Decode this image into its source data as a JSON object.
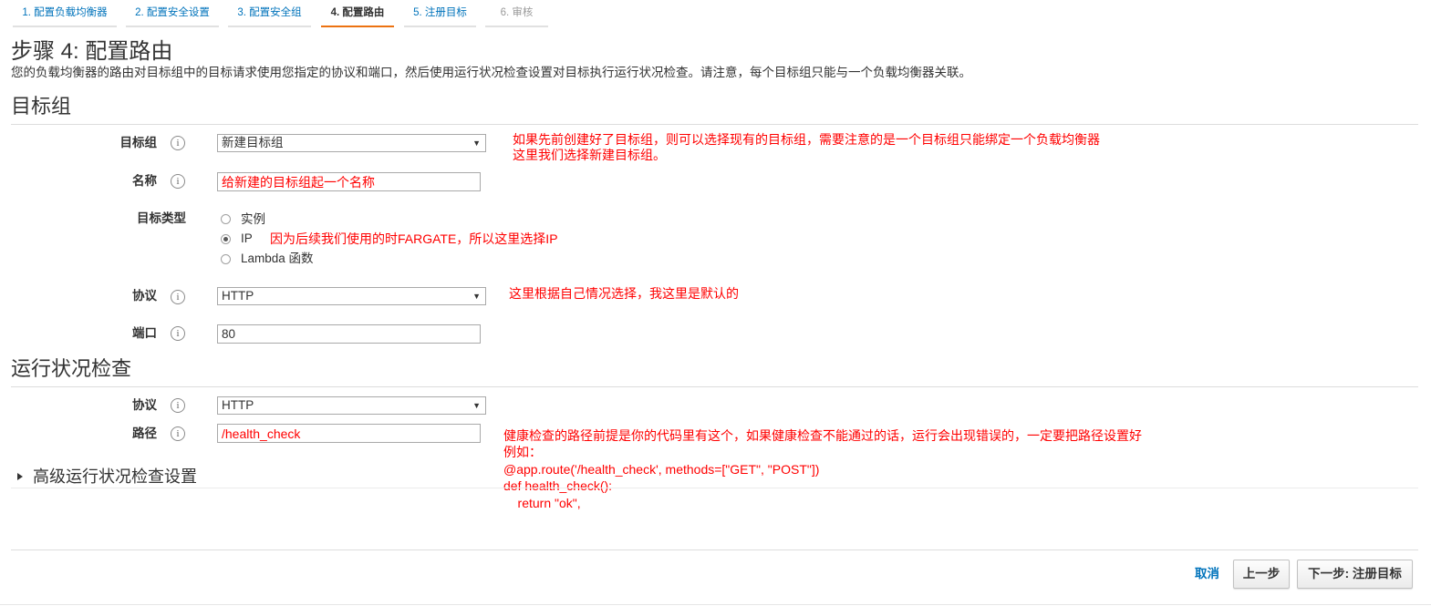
{
  "wizard": {
    "steps": [
      {
        "label": "1. 配置负载均衡器"
      },
      {
        "label": "2. 配置安全设置"
      },
      {
        "label": "3. 配置安全组"
      },
      {
        "label": "4. 配置路由"
      },
      {
        "label": "5. 注册目标"
      },
      {
        "label": "6. 审核"
      }
    ],
    "active_index": 3
  },
  "page": {
    "title": "步骤 4: 配置路由",
    "description": "您的负载均衡器的路由对目标组中的目标请求使用您指定的协议和端口，然后使用运行状况检查设置对目标执行运行状况检查。请注意，每个目标组只能与一个负载均衡器关联。"
  },
  "target_group_section": {
    "title": "目标组",
    "target_group": {
      "label": "目标组",
      "value": "新建目标组"
    },
    "name": {
      "label": "名称",
      "value": "给新建的目标组起一个名称"
    },
    "target_type": {
      "label": "目标类型",
      "options": [
        "实例",
        "IP",
        "Lambda 函数"
      ],
      "selected_index": 1
    },
    "protocol": {
      "label": "协议",
      "value": "HTTP"
    },
    "port": {
      "label": "端口",
      "value": "80"
    }
  },
  "health_check_section": {
    "title": "运行状况检查",
    "protocol": {
      "label": "协议",
      "value": "HTTP"
    },
    "path": {
      "label": "路径",
      "value": "/health_check"
    },
    "advanced_toggle": "高级运行状况检查设置"
  },
  "annotations": {
    "target_group": [
      "如果先前创建好了目标组，则可以选择现有的目标组，需要注意的是一个目标组只能绑定一个负载均衡器",
      "这里我们选择新建目标组。"
    ],
    "target_type": "因为后续我们使用的时FARGATE，所以这里选择IP",
    "protocol": "这里根据自己情况选择，我这里是默认的",
    "health_check_path": [
      "健康检查的路径前提是你的代码里有这个，如果健康检查不能通过的话，运行会出现错误的，一定要把路径设置好",
      "例如：",
      "@app.route('/health_check', methods=[\"GET\", \"POST\"])",
      "def health_check():",
      "    return \"ok\","
    ]
  },
  "footer": {
    "cancel": "取消",
    "previous": "上一步",
    "next": "下一步: 注册目标"
  },
  "colors": {
    "accent": "#ec7211",
    "link": "#0073bb",
    "annotation": "#ff0000"
  },
  "icons": {
    "info": "info-icon",
    "select_arrow": "chevron-down-icon",
    "expand": "caret-right-icon"
  }
}
